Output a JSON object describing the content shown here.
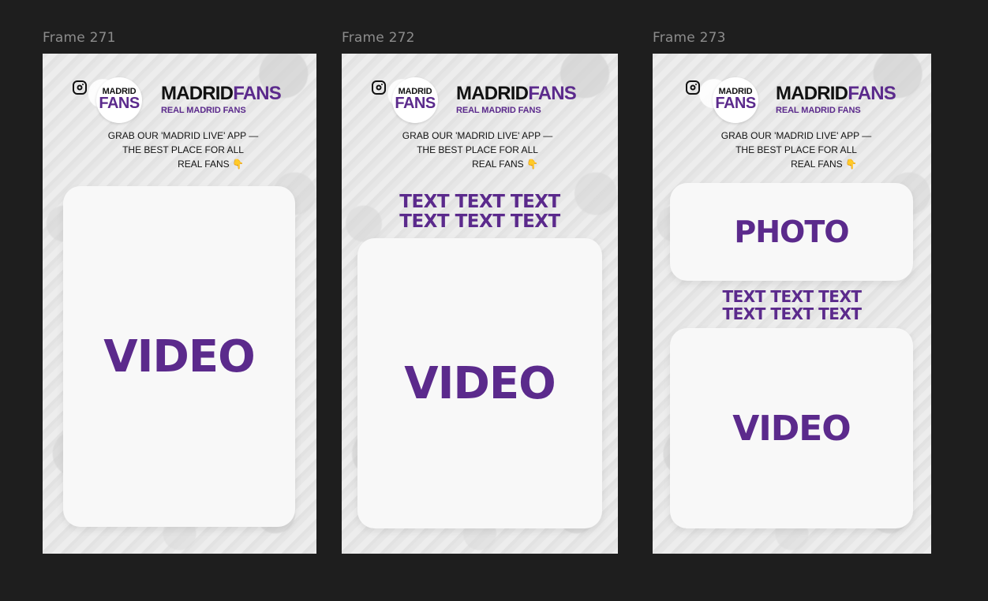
{
  "frames": [
    {
      "label": "Frame 271",
      "instagram": "instagram-icon",
      "logo_top": "MADRID",
      "logo_bottom": "FANS",
      "brand_part1": "MADRID",
      "brand_part2": "FANS",
      "brand_sub": "REAL MADRID FANS",
      "cta_line1": "GRAB OUR 'MADRID LIVE' APP —",
      "cta_line2": "THE BEST PLACE FOR ALL",
      "cta_line3": "REAL FANS",
      "cta_emoji": "👇",
      "video": "VIDEO"
    },
    {
      "label": "Frame 272",
      "instagram": "instagram-icon",
      "logo_top": "MADRID",
      "logo_bottom": "FANS",
      "brand_part1": "MADRID",
      "brand_part2": "FANS",
      "brand_sub": "REAL MADRID FANS",
      "cta_line1": "GRAB OUR 'MADRID LIVE' APP —",
      "cta_line2": "THE BEST PLACE FOR ALL",
      "cta_line3": "REAL FANS",
      "cta_emoji": "👇",
      "text_line1": "TEXT TEXT TEXT",
      "text_line2": "TEXT TEXT TEXT",
      "video": "VIDEO"
    },
    {
      "label": "Frame 273",
      "instagram": "instagram-icon",
      "logo_top": "MADRID",
      "logo_bottom": "FANS",
      "brand_part1": "MADRID",
      "brand_part2": "FANS",
      "brand_sub": "REAL MADRID FANS",
      "cta_line1": "GRAB OUR 'MADRID LIVE' APP —",
      "cta_line2": "THE BEST PLACE FOR ALL",
      "cta_line3": "REAL FANS",
      "cta_emoji": "👇",
      "photo": "PHOTO",
      "text_line1": "TEXT TEXT TEXT",
      "text_line2": "TEXT TEXT TEXT",
      "video": "VIDEO"
    }
  ],
  "colors": {
    "canvas_bg": "#1e1e1e",
    "brand_purple": "#5b2a8c",
    "frame_label": "#8c8c8c"
  }
}
